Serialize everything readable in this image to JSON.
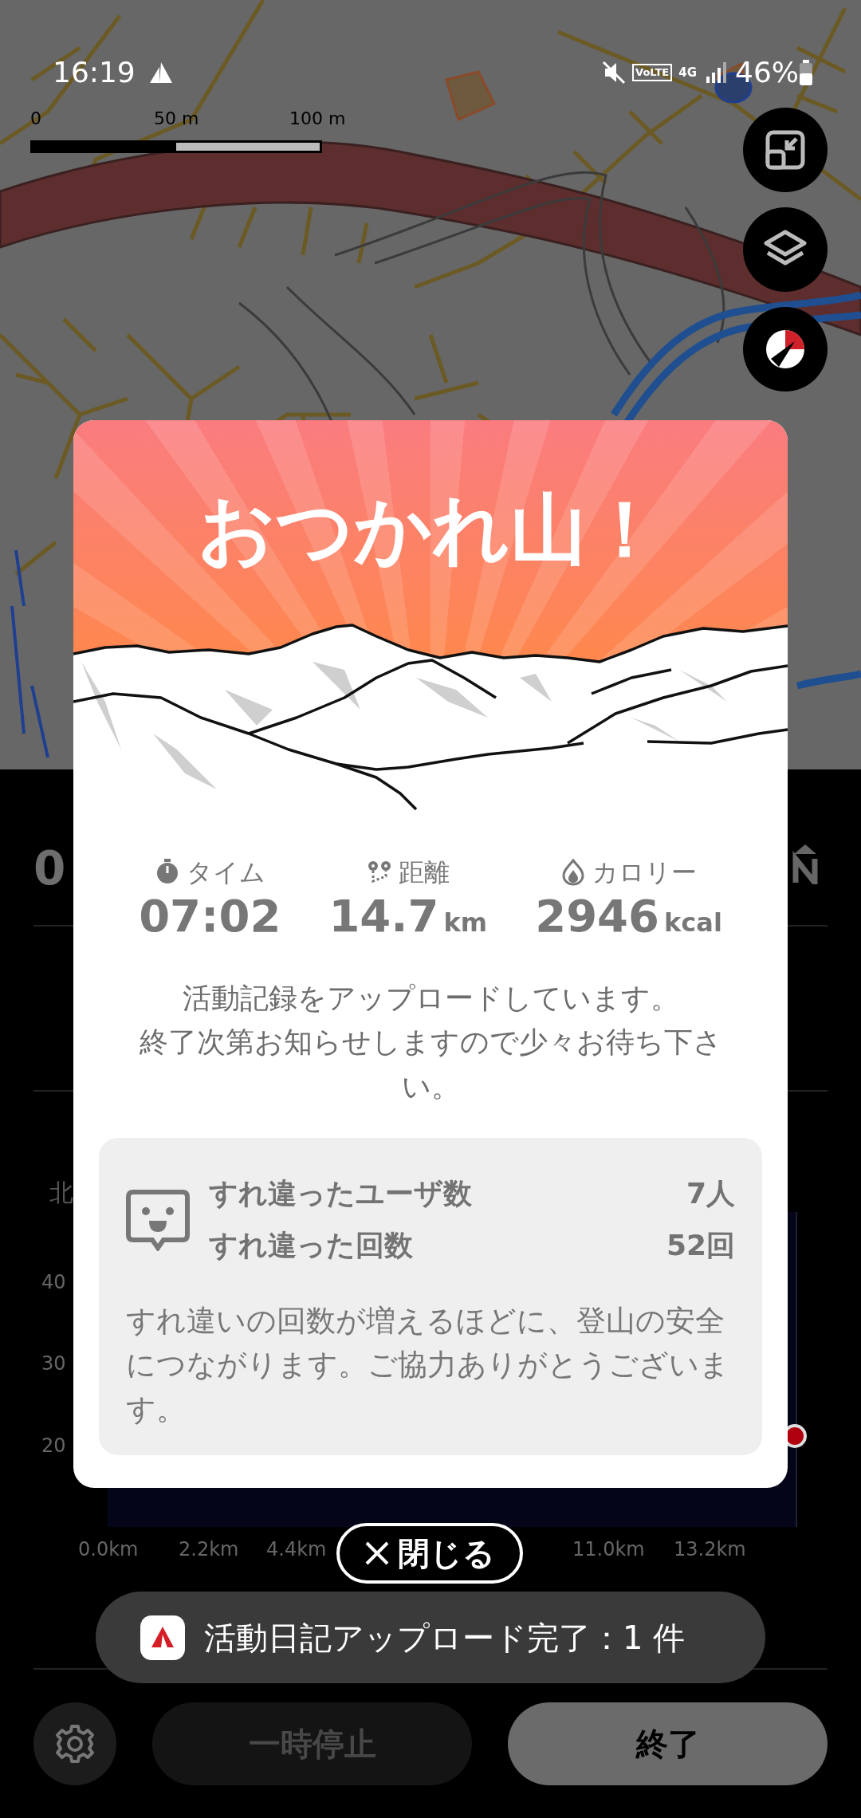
{
  "status_bar": {
    "time": "16:19",
    "volte": "VoLTE",
    "network": "4G",
    "battery": "46%"
  },
  "map": {
    "scale_labels": [
      "0",
      "50 m",
      "100 m"
    ]
  },
  "panel": {
    "partial_stat": "0",
    "chart_label": "北",
    "y_labels": [
      "40",
      "30",
      "20"
    ],
    "x_labels": [
      "0.0km",
      "2.2km",
      "4.4km",
      "11.0km",
      "13.2km"
    ]
  },
  "dialog": {
    "title": "おつかれ山！",
    "stats": [
      {
        "kind": "time",
        "label": "タイム",
        "value": "07:02"
      },
      {
        "kind": "distance",
        "label": "距離",
        "value": "14.7",
        "unit": "km"
      },
      {
        "kind": "calories",
        "label": "カロリー",
        "value": "2946",
        "unit": "kcal"
      }
    ],
    "message_lines": [
      "活動記録をアップロードしています。",
      "終了次第お知らせしますので少々お待ち下さい。"
    ],
    "encounters": {
      "rows": [
        {
          "label": "すれ違ったユーザ数",
          "value": "7人"
        },
        {
          "label": "すれ違った回数",
          "value": "52回"
        }
      ],
      "note": "すれ違いの回数が増えるほどに、登山の安全につながります。ご協力ありがとうございます。"
    }
  },
  "close_button": "閉じる",
  "toast": "活動日記アップロード完了：1 件",
  "bottom_bar": {
    "pause": {
      "label": "一時停止",
      "disabled": true
    },
    "end": {
      "label": "終了",
      "disabled": false
    }
  }
}
